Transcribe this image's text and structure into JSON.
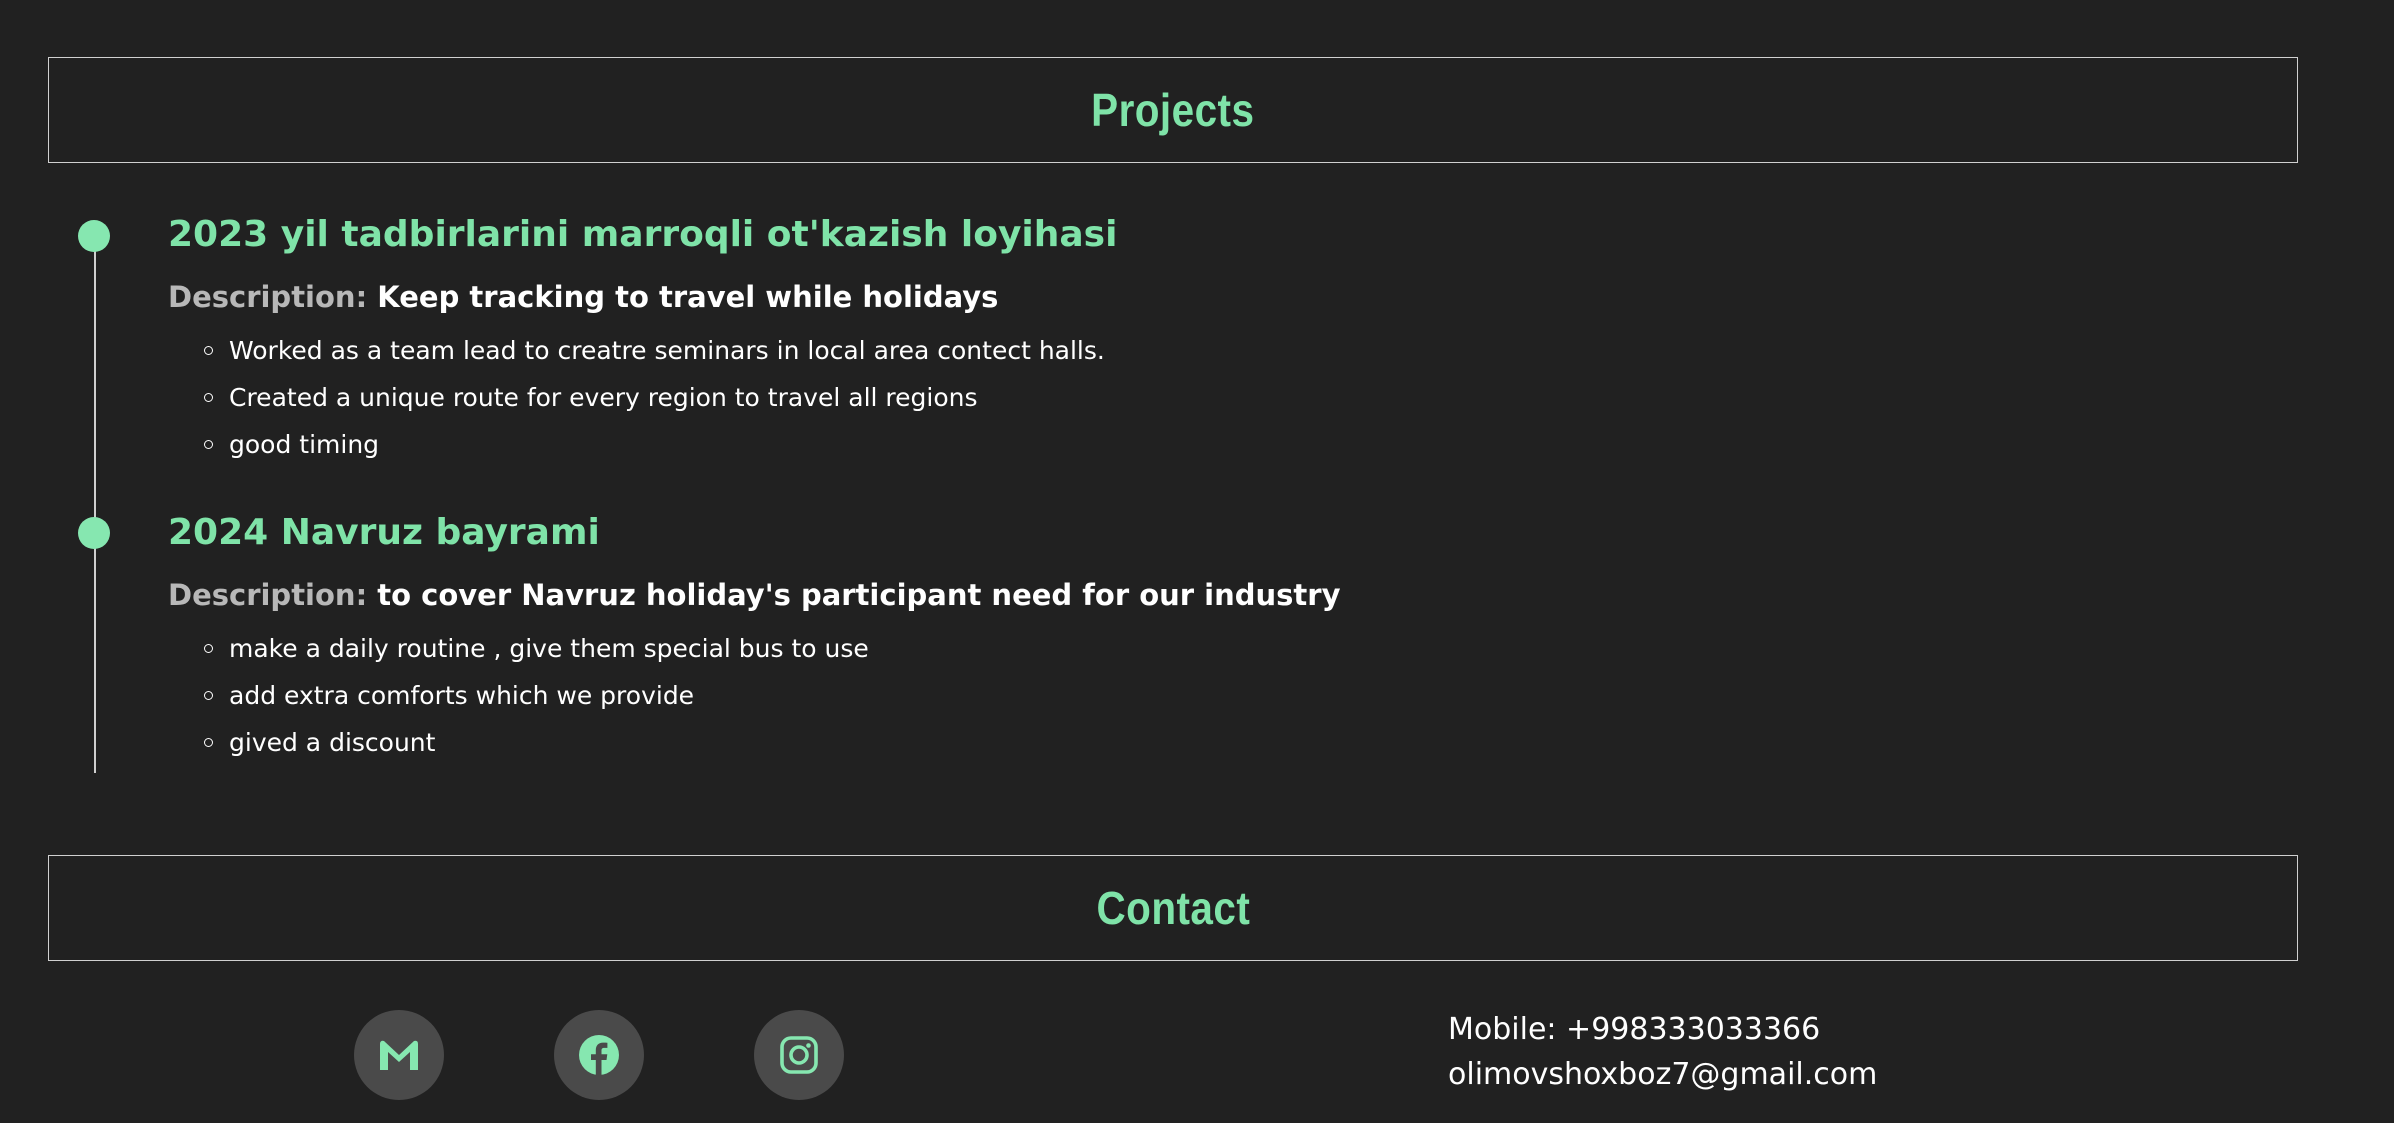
{
  "sections": {
    "projects_title": "Projects",
    "contact_title": "Contact"
  },
  "projects": [
    {
      "title": "2023 yil tadbirlarini marroqli ot'kazish loyihasi",
      "description_label": "Description:",
      "description": "Keep tracking to travel while holidays",
      "items": [
        "Worked as a team lead to creatre seminars in local area contect halls.",
        "Created a unique route for every region to travel all regions",
        "good timing"
      ]
    },
    {
      "title": "2024 Navruz bayrami",
      "description_label": "Description:",
      "description": "to cover Navruz holiday's participant need for our industry",
      "items": [
        "make a daily routine , give them special bus to use",
        "add extra comforts which we provide",
        "gived a discount"
      ]
    }
  ],
  "contact": {
    "mobile": "Mobile: +998333033366",
    "email": "olimovshoxboz7@gmail.com",
    "social_icons": [
      "gmail-icon",
      "facebook-icon",
      "instagram-icon"
    ]
  },
  "colors": {
    "background": "#212121",
    "accent": "#7fe3a8",
    "social_bg": "#4a4a4a"
  }
}
